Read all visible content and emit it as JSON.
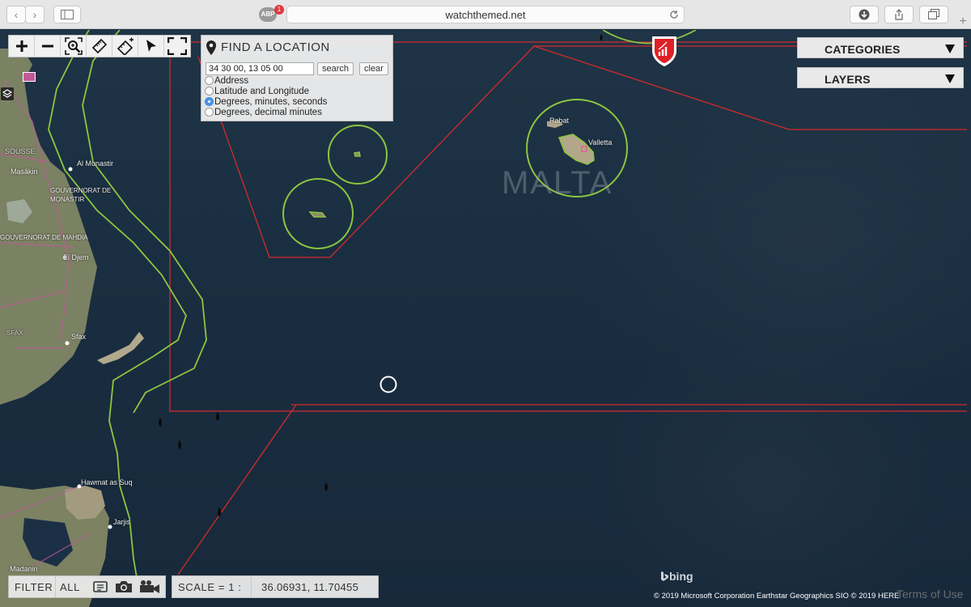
{
  "browser": {
    "url": "watchthemed.net",
    "adblock_label": "ABP",
    "adblock_count": "1"
  },
  "find_location": {
    "title": "FIND A LOCATION",
    "coordinate_value": "34 30 00, 13 05 00",
    "search_label": "search",
    "clear_label": "clear",
    "options": [
      {
        "label": "Address",
        "selected": false
      },
      {
        "label": "Latitude and Longitude",
        "selected": false
      },
      {
        "label": "Degrees, minutes, seconds",
        "selected": true
      },
      {
        "label": "Degrees, decimal minutes",
        "selected": false
      }
    ]
  },
  "menus": {
    "categories_label": "CATEGORIES",
    "layers_label": "LAYERS"
  },
  "map": {
    "country_label": "MALTA",
    "places": {
      "rabat": "Rabat",
      "valletta": "Valletta",
      "sousse": "SOUSSE",
      "masakin": "Masâkin",
      "al_munastir": "Al Munastir",
      "gouvernorat_monastir": "GOUVERNORAT DE MONASTIR",
      "gouvernorat_mahdia": "GOUVERNORAT DE MAHDIA",
      "el_djem": "El Djem",
      "sfax_region": "SFAX",
      "sfax": "Sfax",
      "hawmat": "Hawmat as Suq",
      "jarjis": "Jarjis",
      "madanin": "Madanin"
    },
    "attribution": "© 2019 Microsoft Corporation Earthstar Geographics SIO © 2019 HERE",
    "bing_label": "bing",
    "terms_label": "Terms of Use"
  },
  "bottom_bar": {
    "filter_label": "FILTER",
    "all_label": "ALL",
    "scale_label": "SCALE = 1 :",
    "coordinates": "36.06931, 11.70455"
  },
  "colors": {
    "sea": "#1a2e41",
    "zone_line": "#d42a2a",
    "sar_line": "#8cc63f",
    "brand_red": "#e11f26"
  }
}
